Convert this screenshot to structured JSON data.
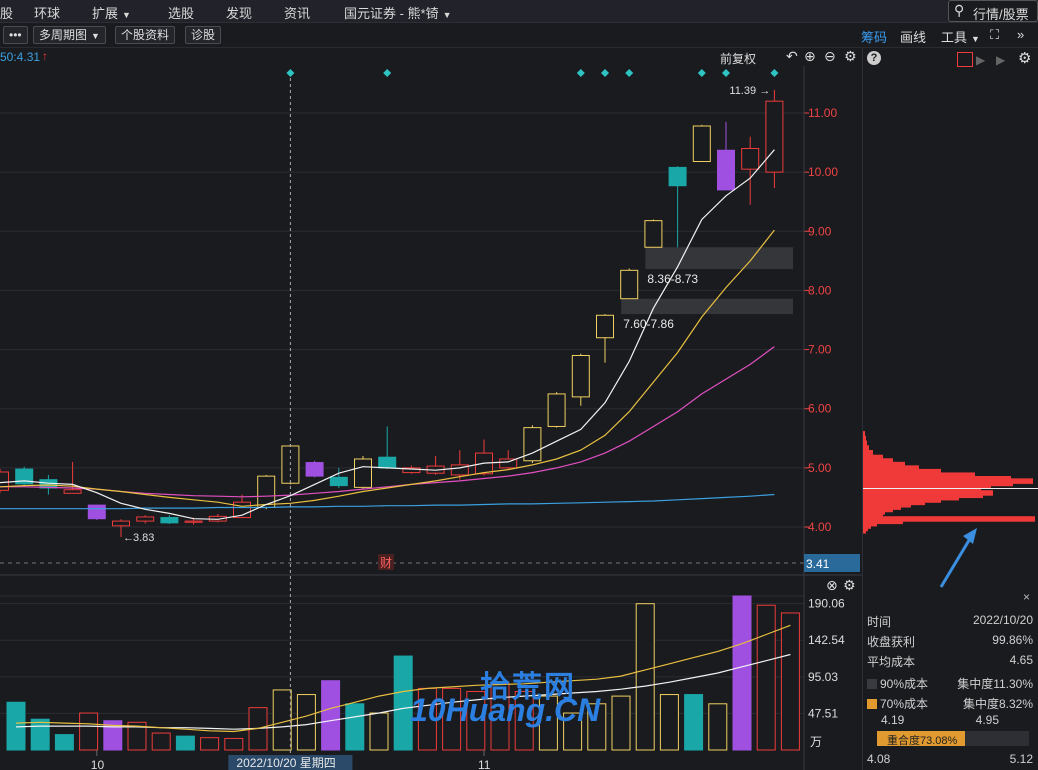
{
  "menubar": {
    "items": [
      {
        "label": "股",
        "x": 0
      },
      {
        "label": "环球",
        "x": 34
      },
      {
        "label": "扩展",
        "x": 92,
        "caret": true
      },
      {
        "label": "选股",
        "x": 168
      },
      {
        "label": "发现",
        "x": 226
      },
      {
        "label": "资讯",
        "x": 284
      },
      {
        "label": "国元证券 - 熊*锜",
        "x": 344,
        "caret": true
      }
    ],
    "search_text": "行情/股票"
  },
  "toolbar": {
    "more": "•••",
    "multi_period": "多周期图",
    "stock_info": "个股资料",
    "diagnose": "诊股",
    "chips": "筹码",
    "draw": "画线",
    "tools": "工具",
    "expand": "»"
  },
  "infobar": {
    "ma_text": "50:4.31",
    "fuquan": "前复权"
  },
  "colors": {
    "up": "#ee3b3b",
    "down": "#1aa7a7",
    "yellow_box": "#f0d060",
    "purple": "#a050e0",
    "ma5": "#f2f2f2",
    "ma10": "#e8c040",
    "ma20": "#e050c0",
    "ma60": "#3aa0e0",
    "axis": "#ee4444",
    "accent": "#2e8be6"
  },
  "chart_data": [
    {
      "type": "candlestick",
      "ylim": [
        3.41,
        11.39
      ],
      "y_ticks": [
        "11.00",
        "10.00",
        "9.00",
        "8.00",
        "7.00",
        "6.00",
        "5.00",
        "4.00"
      ],
      "current_price_label": "3.41",
      "high_label": "11.39",
      "low_label": "3.83",
      "zones": [
        {
          "label": "8.36-8.73",
          "low": 8.36,
          "high": 8.73
        },
        {
          "label": "7.60-7.86",
          "low": 7.6,
          "high": 7.86
        }
      ],
      "cursor_date": "2022/10/20 星期四",
      "x_labels": [
        {
          "label": "10",
          "index": 4
        },
        {
          "label": "11",
          "index": 20
        }
      ],
      "finance_marker": "财",
      "candles": [
        {
          "o": 4.62,
          "c": 4.93,
          "h": 4.98,
          "l": 4.58,
          "s": "up"
        },
        {
          "o": 4.98,
          "c": 4.73,
          "h": 5.02,
          "l": 4.7,
          "s": "down"
        },
        {
          "o": 4.8,
          "c": 4.66,
          "h": 4.88,
          "l": 4.55,
          "s": "down"
        },
        {
          "o": 4.57,
          "c": 4.63,
          "h": 5.1,
          "l": 4.57,
          "s": "up"
        },
        {
          "o": 4.37,
          "c": 4.14,
          "h": 4.38,
          "l": 4.12,
          "s": "purple"
        },
        {
          "o": 4.02,
          "c": 4.1,
          "h": 4.13,
          "l": 3.83,
          "s": "up"
        },
        {
          "o": 4.1,
          "c": 4.17,
          "h": 4.2,
          "l": 4.06,
          "s": "up"
        },
        {
          "o": 4.16,
          "c": 4.07,
          "h": 4.2,
          "l": 4.05,
          "s": "down"
        },
        {
          "o": 4.08,
          "c": 4.1,
          "h": 4.16,
          "l": 4.04,
          "s": "up"
        },
        {
          "o": 4.1,
          "c": 4.18,
          "h": 4.22,
          "l": 4.08,
          "s": "up"
        },
        {
          "o": 4.16,
          "c": 4.42,
          "h": 4.55,
          "l": 4.15,
          "s": "up"
        },
        {
          "o": 4.33,
          "c": 4.86,
          "h": 4.88,
          "l": 4.3,
          "s": "yellow"
        },
        {
          "o": 4.74,
          "c": 5.37,
          "h": 5.4,
          "l": 4.72,
          "s": "yellow"
        },
        {
          "o": 5.09,
          "c": 4.86,
          "h": 5.12,
          "l": 4.84,
          "s": "purple"
        },
        {
          "o": 4.84,
          "c": 4.7,
          "h": 5.0,
          "l": 4.66,
          "s": "down"
        },
        {
          "o": 4.67,
          "c": 5.15,
          "h": 5.2,
          "l": 4.65,
          "s": "yellow"
        },
        {
          "o": 5.18,
          "c": 5.0,
          "h": 5.7,
          "l": 4.98,
          "s": "down"
        },
        {
          "o": 4.92,
          "c": 5.0,
          "h": 5.04,
          "l": 4.9,
          "s": "up"
        },
        {
          "o": 4.91,
          "c": 5.03,
          "h": 5.2,
          "l": 4.88,
          "s": "up"
        },
        {
          "o": 4.88,
          "c": 5.05,
          "h": 5.3,
          "l": 4.8,
          "s": "up"
        },
        {
          "o": 4.9,
          "c": 5.25,
          "h": 5.48,
          "l": 4.87,
          "s": "up"
        },
        {
          "o": 5.0,
          "c": 5.15,
          "h": 5.3,
          "l": 4.98,
          "s": "up"
        },
        {
          "o": 5.12,
          "c": 5.68,
          "h": 5.72,
          "l": 5.08,
          "s": "yellow"
        },
        {
          "o": 5.7,
          "c": 6.25,
          "h": 6.28,
          "l": 5.68,
          "s": "yellow"
        },
        {
          "o": 6.2,
          "c": 6.9,
          "h": 6.93,
          "l": 6.05,
          "s": "yellow"
        },
        {
          "o": 7.2,
          "c": 7.58,
          "h": 7.6,
          "l": 6.78,
          "s": "yellow"
        },
        {
          "o": 7.86,
          "c": 8.34,
          "h": 8.37,
          "l": 7.86,
          "s": "yellow"
        },
        {
          "o": 8.73,
          "c": 9.18,
          "h": 9.2,
          "l": 8.73,
          "s": "yellow"
        },
        {
          "o": 10.08,
          "c": 9.77,
          "h": 10.1,
          "l": 8.73,
          "s": "down"
        },
        {
          "o": 10.18,
          "c": 10.78,
          "h": 10.8,
          "l": 10.18,
          "s": "yellow"
        },
        {
          "o": 10.37,
          "c": 9.7,
          "h": 10.85,
          "l": 9.7,
          "s": "purple"
        },
        {
          "o": 10.05,
          "c": 10.4,
          "h": 10.6,
          "l": 9.45,
          "s": "up"
        },
        {
          "o": 10.0,
          "c": 11.2,
          "h": 11.39,
          "l": 9.73,
          "s": "up"
        }
      ],
      "ma5": [
        4.75,
        4.78,
        4.74,
        4.72,
        4.58,
        4.4,
        4.3,
        4.23,
        4.14,
        4.13,
        4.2,
        4.38,
        4.53,
        4.72,
        4.91,
        5.02,
        5.0,
        4.98,
        4.96,
        5.0,
        5.08,
        5.1,
        5.25,
        5.45,
        5.65,
        6.1,
        6.8,
        7.7,
        8.4,
        9.2,
        9.6,
        9.9,
        10.38
      ],
      "ma10": [
        4.68,
        4.7,
        4.71,
        4.69,
        4.64,
        4.6,
        4.55,
        4.5,
        4.46,
        4.42,
        4.35,
        4.38,
        4.4,
        4.45,
        4.52,
        4.6,
        4.66,
        4.72,
        4.78,
        4.85,
        4.92,
        4.97,
        5.05,
        5.15,
        5.3,
        5.55,
        5.95,
        6.45,
        6.95,
        7.55,
        8.05,
        8.5,
        9.02
      ],
      "ma20": [
        4.68,
        4.68,
        4.67,
        4.66,
        4.64,
        4.6,
        4.57,
        4.55,
        4.53,
        4.52,
        4.51,
        4.52,
        4.54,
        4.57,
        4.6,
        4.64,
        4.68,
        4.72,
        4.75,
        4.78,
        4.82,
        4.86,
        4.92,
        5.0,
        5.1,
        5.25,
        5.45,
        5.7,
        5.95,
        6.25,
        6.5,
        6.75,
        7.05
      ],
      "ma60": [
        4.31,
        4.31,
        4.31,
        4.31,
        4.31,
        4.31,
        4.32,
        4.32,
        4.32,
        4.33,
        4.33,
        4.33,
        4.34,
        4.34,
        4.35,
        4.35,
        4.36,
        4.36,
        4.37,
        4.37,
        4.38,
        4.39,
        4.39,
        4.4,
        4.41,
        4.42,
        4.43,
        4.44,
        4.46,
        4.48,
        4.5,
        4.52,
        4.55
      ]
    },
    {
      "type": "bar",
      "y_ticks": [
        "190.06",
        "142.54",
        "95.03",
        "47.51"
      ],
      "unit": "万",
      "ylim": [
        0,
        200
      ],
      "volumes": [
        62,
        40,
        20,
        48,
        38,
        36,
        22,
        18,
        16,
        15,
        55,
        78,
        72,
        90,
        60,
        48,
        122,
        80,
        80,
        76,
        86,
        76,
        70,
        48,
        60,
        70,
        190,
        72,
        72,
        60,
        200,
        188,
        178,
        172,
        168
      ],
      "vol_styles": [
        "down",
        "down",
        "down",
        "up",
        "purple",
        "up",
        "up",
        "down",
        "up",
        "up",
        "up",
        "yellow",
        "yellow",
        "purple",
        "down",
        "yellow",
        "down",
        "up",
        "up",
        "up",
        "up",
        "up",
        "yellow",
        "yellow",
        "yellow",
        "yellow",
        "yellow",
        "yellow",
        "down",
        "yellow",
        "purple",
        "up",
        "up",
        "up",
        "up"
      ],
      "vma5": [
        35,
        36,
        35,
        34,
        32,
        31,
        29,
        27,
        25,
        24,
        28,
        36,
        44,
        54,
        62,
        70,
        76,
        80,
        82,
        84,
        85,
        86,
        88,
        90,
        92,
        96,
        104,
        112,
        120,
        128,
        138,
        150,
        162,
        172,
        180
      ],
      "vma10": [
        30,
        31,
        31,
        31,
        30,
        30,
        29,
        29,
        28,
        27,
        28,
        30,
        33,
        38,
        43,
        48,
        54,
        58,
        62,
        65,
        68,
        70,
        72,
        74,
        76,
        79,
        83,
        88,
        94,
        100,
        108,
        116,
        124,
        132,
        138
      ]
    }
  ],
  "right_panel": {
    "time_label": "时间",
    "time_value": "2022/10/20",
    "profit_label": "收盘获利",
    "profit_value": "99.86%",
    "avg_cost_label": "平均成本",
    "avg_cost_value": "4.65",
    "cost90_label": "90%成本",
    "conc90_label": "集中度11.30%",
    "cost70_label": "70%成本",
    "conc70_label": "集中度8.32%",
    "range_low": "4.19",
    "range_high": "4.95",
    "overlap_label": "重合度73.08%",
    "overlap_ratio": 0.731,
    "bottom_low": "4.08",
    "bottom_high": "5.12",
    "close_x": "×",
    "chip_profile": [
      {
        "p": 5.58,
        "w": 2
      },
      {
        "p": 5.5,
        "w": 3
      },
      {
        "p": 5.42,
        "w": 4
      },
      {
        "p": 5.34,
        "w": 6
      },
      {
        "p": 5.26,
        "w": 10
      },
      {
        "p": 5.18,
        "w": 20
      },
      {
        "p": 5.12,
        "w": 30
      },
      {
        "p": 5.06,
        "w": 42
      },
      {
        "p": 5.0,
        "w": 56
      },
      {
        "p": 4.94,
        "w": 78
      },
      {
        "p": 4.88,
        "w": 112
      },
      {
        "p": 4.82,
        "w": 148
      },
      {
        "p": 4.78,
        "w": 170
      },
      {
        "p": 4.74,
        "w": 150
      },
      {
        "p": 4.7,
        "w": 128
      },
      {
        "p": 4.66,
        "w": 110
      },
      {
        "p": 4.62,
        "w": 118
      },
      {
        "p": 4.58,
        "w": 130
      },
      {
        "p": 4.54,
        "w": 120
      },
      {
        "p": 4.5,
        "w": 96
      },
      {
        "p": 4.46,
        "w": 78
      },
      {
        "p": 4.42,
        "w": 62
      },
      {
        "p": 4.38,
        "w": 48
      },
      {
        "p": 4.34,
        "w": 38
      },
      {
        "p": 4.3,
        "w": 30
      },
      {
        "p": 4.26,
        "w": 22
      },
      {
        "p": 4.22,
        "w": 16
      },
      {
        "p": 4.18,
        "w": 20
      },
      {
        "p": 4.14,
        "w": 172
      },
      {
        "p": 4.1,
        "w": 40
      },
      {
        "p": 4.06,
        "w": 14
      },
      {
        "p": 4.02,
        "w": 8
      },
      {
        "p": 3.98,
        "w": 5
      },
      {
        "p": 3.94,
        "w": 3
      }
    ]
  },
  "watermark": {
    "line1": "拾荒网",
    "line2": "10Huang.CN"
  }
}
